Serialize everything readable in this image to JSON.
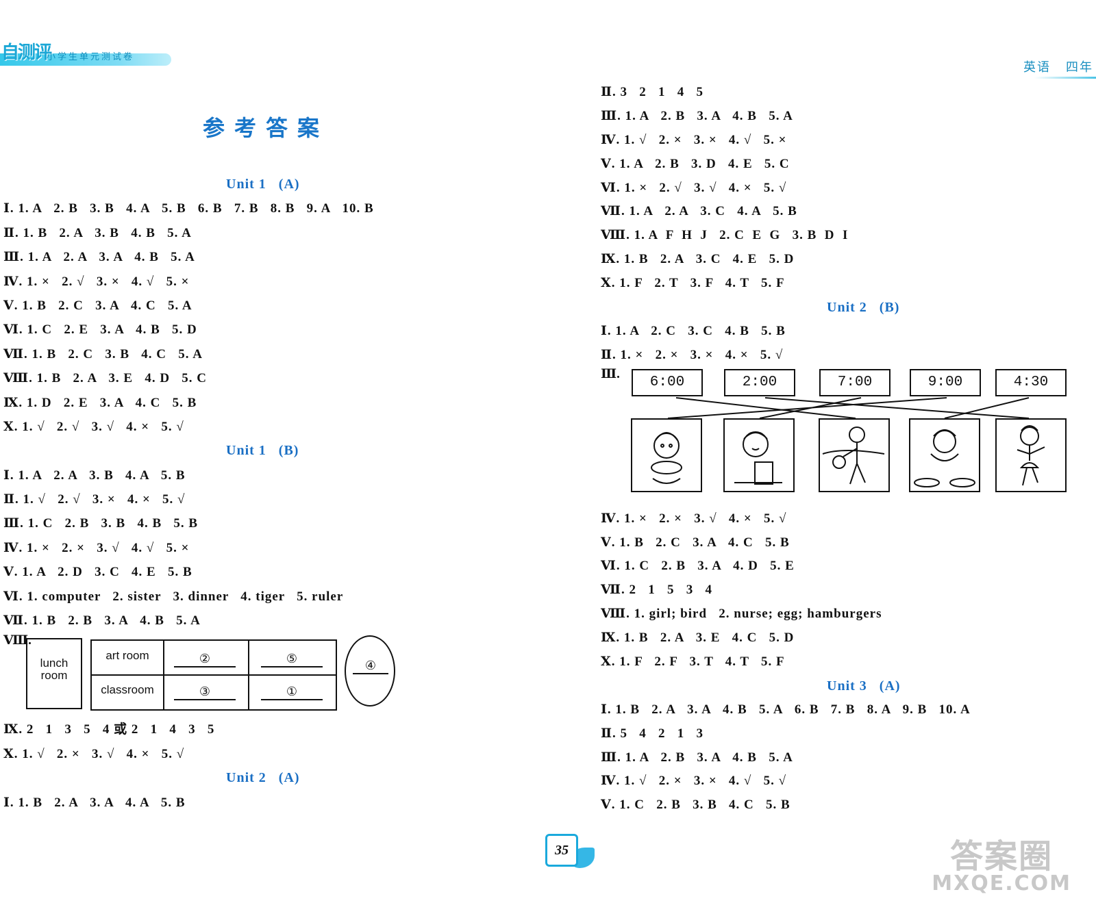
{
  "header": {
    "logo": "自测评",
    "subtitle": "小学生单元测试卷",
    "subject": "英语",
    "grade": "四年"
  },
  "title": "参考答案",
  "left": {
    "unit1a": {
      "heading": "Unit 1   (A)",
      "lines": [
        "Ⅰ. 1. A   2. B   3. B   4. A   5. B   6. B   7. B   8. B   9. A   10. B",
        "Ⅱ. 1. B   2. A   3. B   4. B   5. A",
        "Ⅲ. 1. A   2. A   3. A   4. B   5. A",
        "Ⅳ. 1. ×   2. √   3. ×   4. √   5. ×",
        "Ⅴ. 1. B   2. C   3. A   4. C   5. A",
        "Ⅵ. 1. C   2. E   3. A   4. B   5. D",
        "Ⅶ. 1. B   2. C   3. B   4. C   5. A",
        "Ⅷ. 1. B   2. A   3. E   4. D   5. C",
        "Ⅸ. 1. D   2. E   3. A   4. C   5. B",
        "Ⅹ. 1. √   2. √   3. √   4. ×   5. √"
      ]
    },
    "unit1b": {
      "heading": "Unit 1   (B)",
      "lines": [
        "Ⅰ. 1. A   2. A   3. B   4. A   5. B",
        "Ⅱ. 1. √   2. √   3. ×   4. ×   5. √",
        "Ⅲ. 1. C   2. B   3. B   4. B   5. B",
        "Ⅳ. 1. ×   2. ×   3. √   4. √   5. ×",
        "Ⅴ. 1. A   2. D   3. C   4. E   5. B",
        "Ⅵ. 1. computer   2. sister   3. dinner   4. tiger   5. ruler",
        "Ⅶ. 1. B   2. B   3. A   4. B   5. A"
      ],
      "table": {
        "label": "Ⅷ.",
        "lunch_room": "lunch room",
        "art_room": "art room",
        "classroom": "classroom",
        "a1": "②",
        "a2": "⑤",
        "a3": "③",
        "a4": "①",
        "a5": "④"
      },
      "after": [
        "Ⅸ. 2   1   3   5   4 或 2   1   4   3   5",
        "Ⅹ. 1. √   2. ×   3. √   4. ×   5. √"
      ]
    },
    "unit2a": {
      "heading": "Unit 2   (A)",
      "lines": [
        "Ⅰ. 1. B   2. A   3. A   4. A   5. B"
      ]
    }
  },
  "right": {
    "unit2a_cont": {
      "lines": [
        "Ⅱ. 3   2   1   4   5",
        "Ⅲ. 1. A   2. B   3. A   4. B   5. A",
        "Ⅳ. 1. √   2. ×   3. ×   4. √   5. ×",
        "Ⅴ. 1. A   2. B   3. D   4. E   5. C",
        "Ⅵ. 1. ×   2. √   3. √   4. ×   5. √",
        "Ⅶ. 1. A   2. A   3. C   4. A   5. B",
        "Ⅷ. 1. A  F  H  J   2. C  E  G   3. B  D  I",
        "Ⅸ. 1. B   2. A   3. C   4. E   5. D",
        "Ⅹ. 1. F   2. T   3. F   4. T   5. F"
      ]
    },
    "unit2b": {
      "heading": "Unit 2   (B)",
      "lines": [
        "Ⅰ. 1. A   2. C   3. C   4. B   5. B",
        "Ⅱ. 1. ×   2. ×   3. ×   4. ×   5. √"
      ],
      "match": {
        "label": "Ⅲ.",
        "times": [
          "6:00",
          "2:00",
          "7:00",
          "9:00",
          "4:30"
        ]
      },
      "after": [
        "Ⅳ. 1. ×   2. ×   3. √   4. ×   5. √",
        "Ⅴ. 1. B   2. C   3. A   4. C   5. B",
        "Ⅵ. 1. C   2. B   3. A   4. D   5. E",
        "Ⅶ. 2   1   5   3   4",
        "Ⅷ. 1. girl; bird   2. nurse; egg; hamburgers",
        "Ⅸ. 1. B   2. A   3. E   4. C   5. D",
        "Ⅹ. 1. F   2. F   3. T   4. T   5. F"
      ]
    },
    "unit3a": {
      "heading": "Unit 3   (A)",
      "lines": [
        "Ⅰ. 1. B   2. A   3. A   4. B   5. A   6. B   7. B   8. A   9. B   10. A",
        "Ⅱ. 5   4   2   1   3",
        "Ⅲ. 1. A   2. B   3. A   4. B   5. A",
        "Ⅳ. 1. √   2. ×   3. ×   4. √   5. √",
        "Ⅴ. 1. C   2. B   3. B   4. C   5. B"
      ]
    }
  },
  "page_number": "35",
  "watermark": {
    "line1": "答案圈",
    "line2": "MXQE.COM"
  },
  "colors": {
    "accent": "#1a6fc4",
    "banner": "#35c8ea"
  }
}
